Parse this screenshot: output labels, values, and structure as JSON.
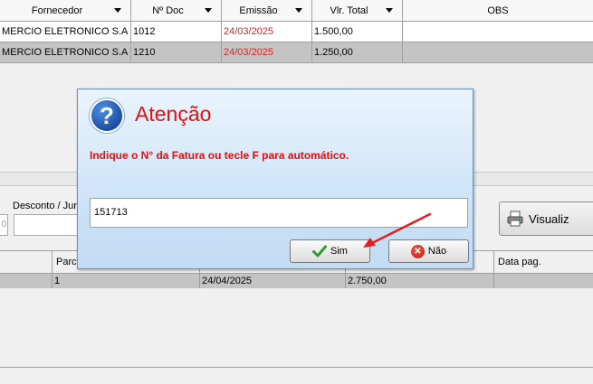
{
  "grid_top": {
    "columns": [
      {
        "label": "Fornecedor",
        "sort": true
      },
      {
        "label": "Nº Doc",
        "sort": true
      },
      {
        "label": "Emissão",
        "sort": true
      },
      {
        "label": "Vlr. Total",
        "sort": true
      },
      {
        "label": "OBS",
        "sort": false
      }
    ],
    "rows": [
      {
        "fornecedor": "MERCIO ELETRONICO S.A",
        "doc": "1012",
        "emissao": "24/03/2025",
        "total": "1.500,00",
        "selected": false
      },
      {
        "fornecedor": "MERCIO ELETRONICO S.A",
        "doc": "1210",
        "emissao": "24/03/2025",
        "total": "1.250,00",
        "selected": true
      }
    ]
  },
  "middle": {
    "desconto_label": "Desconto / Jur",
    "left_field_value": "0",
    "visualizar_label": "Visualiz"
  },
  "grid_bottom": {
    "columns": [
      "",
      "Parc",
      "",
      "",
      "Data pag."
    ],
    "row": {
      "parcela": "1",
      "vencimento": "24/04/2025",
      "valor": "2.750,00"
    }
  },
  "dialog": {
    "icon": "question-icon",
    "title": "Atenção",
    "message": "Indique o N° da Fatura ou tecle F para automático.",
    "input_value": "151713",
    "yes_label": "Sim",
    "no_label": "Não",
    "accent_color": "#e01010"
  }
}
